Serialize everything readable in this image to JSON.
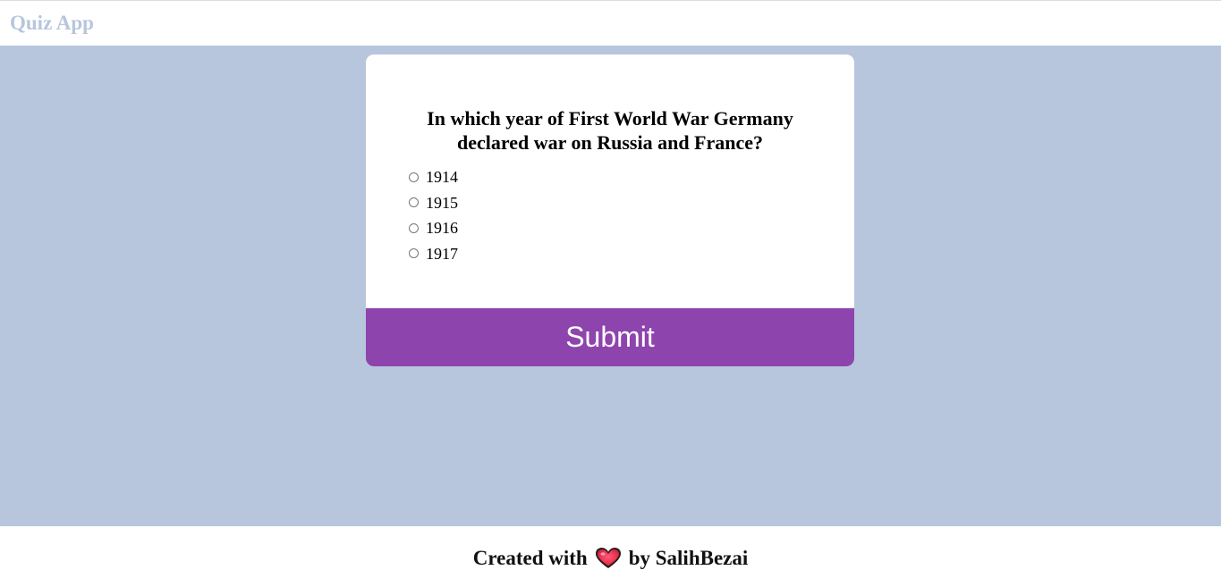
{
  "header": {
    "title": "Quiz App"
  },
  "quiz": {
    "question": "In which year of First World War Germany declared war on Russia and France?",
    "answers": [
      {
        "label": "1914",
        "selected": false
      },
      {
        "label": "1915",
        "selected": false
      },
      {
        "label": "1916",
        "selected": false
      },
      {
        "label": "1917",
        "selected": false
      }
    ],
    "submit_label": "Submit"
  },
  "footer": {
    "prefix": "Created with",
    "icon": "heart-icon",
    "suffix": "by SalihBezai"
  },
  "colors": {
    "page_background": "#b7c6dc",
    "header_title": "#b7c6dc",
    "submit_button": "#8e44ad",
    "heart": "#e8304c"
  }
}
